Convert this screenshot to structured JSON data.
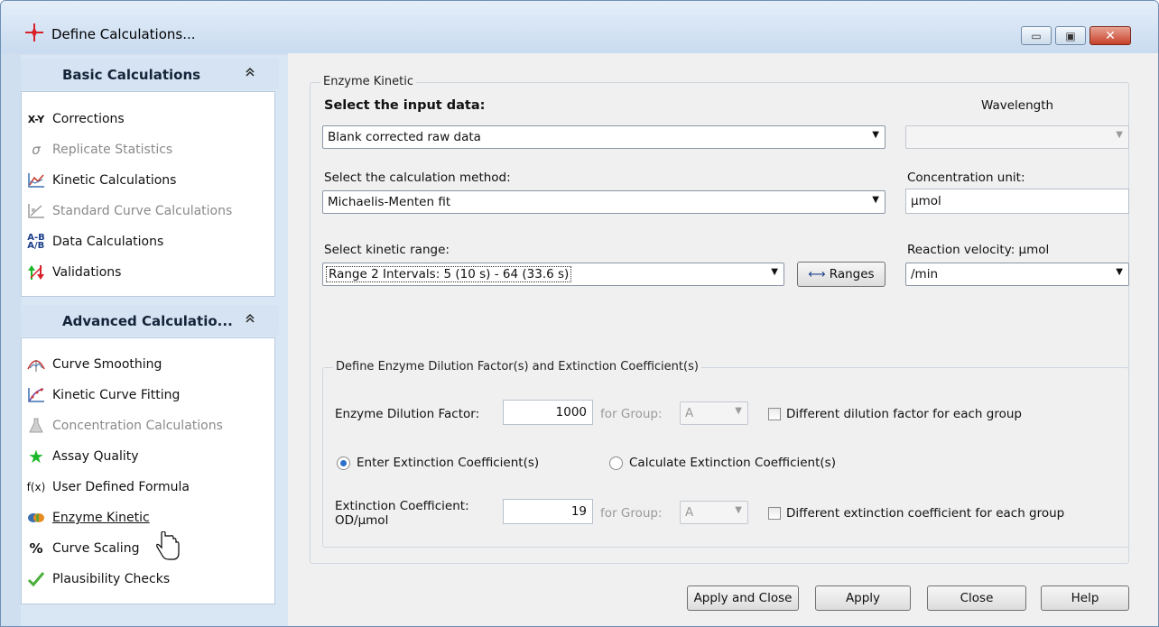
{
  "window": {
    "title": "Define Calculations...",
    "min_glyph": "▭",
    "max_glyph": "▣",
    "close_glyph": "✕"
  },
  "sidebar": {
    "basic": {
      "title": "Basic Calculations",
      "items": [
        {
          "label": "Corrections",
          "icon": "x-y-icon",
          "glyph": "X-Y",
          "enabled": true
        },
        {
          "label": "Replicate Statistics",
          "icon": "sigma-icon",
          "glyph": "σ",
          "enabled": false
        },
        {
          "label": "Kinetic Calculations",
          "icon": "kinetic-chart-icon",
          "enabled": true
        },
        {
          "label": "Standard Curve Calculations",
          "icon": "standard-curve-icon",
          "enabled": false
        },
        {
          "label": "Data Calculations",
          "icon": "a-b-icon",
          "glyph": "A-B",
          "enabled": true
        },
        {
          "label": "Validations",
          "icon": "validation-arrows-icon",
          "enabled": true
        }
      ]
    },
    "advanced": {
      "title": "Advanced Calculatio...",
      "items": [
        {
          "label": "Curve Smoothing",
          "icon": "curve-smoothing-icon",
          "enabled": true
        },
        {
          "label": "Kinetic Curve Fitting",
          "icon": "curve-fitting-icon",
          "enabled": true
        },
        {
          "label": "Concentration Calculations",
          "icon": "flask-icon",
          "enabled": false
        },
        {
          "label": "Assay Quality",
          "icon": "star-icon",
          "enabled": true
        },
        {
          "label": "User Defined Formula",
          "icon": "fx-icon",
          "glyph": "f(x)",
          "enabled": true
        },
        {
          "label": "Enzyme Kinetic",
          "icon": "enzyme-icon",
          "enabled": true
        },
        {
          "label": "Curve Scaling",
          "icon": "percent-icon",
          "glyph": "%",
          "enabled": true
        },
        {
          "label": "Plausibility Checks",
          "icon": "checkmark-icon",
          "enabled": true
        }
      ]
    },
    "chevron": "⌃"
  },
  "enzyme": {
    "group_title": "Enzyme Kinetic",
    "input_label": "Select the input data:",
    "input_value": "Blank corrected raw data",
    "wavelength_label": "Wavelength",
    "wavelength_value": "",
    "method_label": "Select the calculation method:",
    "method_value": "Michaelis-Menten fit",
    "conc_label": "Concentration unit:",
    "conc_value": "µmol",
    "range_label": "Select kinetic range:",
    "range_value": "Range 2 Intervals: 5 (10 s) - 64 (33.6 s)",
    "ranges_button": "Ranges",
    "velocity_label": "Reaction velocity: µmol",
    "velocity_value": "/min"
  },
  "dilution": {
    "group_title": "Define Enzyme Dilution Factor(s) and Extinction Coefficient(s)",
    "factor_label": "Enzyme Dilution Factor:",
    "factor_value": "1000",
    "for_group_label": "for Group:",
    "group_value": "A",
    "diff_factor_label": "Different dilution factor for each group",
    "diff_factor_checked": false,
    "radio_enter": "Enter Extinction Coefficient(s)",
    "radio_calc": "Calculate Extinction Coefficient(s)",
    "radio_selected": "enter",
    "ext_label_line1": "Extinction Coefficient:",
    "ext_label_line2": "OD/µmol",
    "ext_value": "19",
    "ext_for_group_label": "for Group:",
    "ext_group_value": "A",
    "diff_ext_label": "Different extinction coefficient for each group",
    "diff_ext_checked": false
  },
  "footer": {
    "apply_close": "Apply and Close",
    "apply": "Apply",
    "close": "Close",
    "help": "Help"
  },
  "colors": {
    "accent_blue": "#2a6fc9",
    "title_icon_red": "#d8202a",
    "star_green": "#1db82a"
  }
}
